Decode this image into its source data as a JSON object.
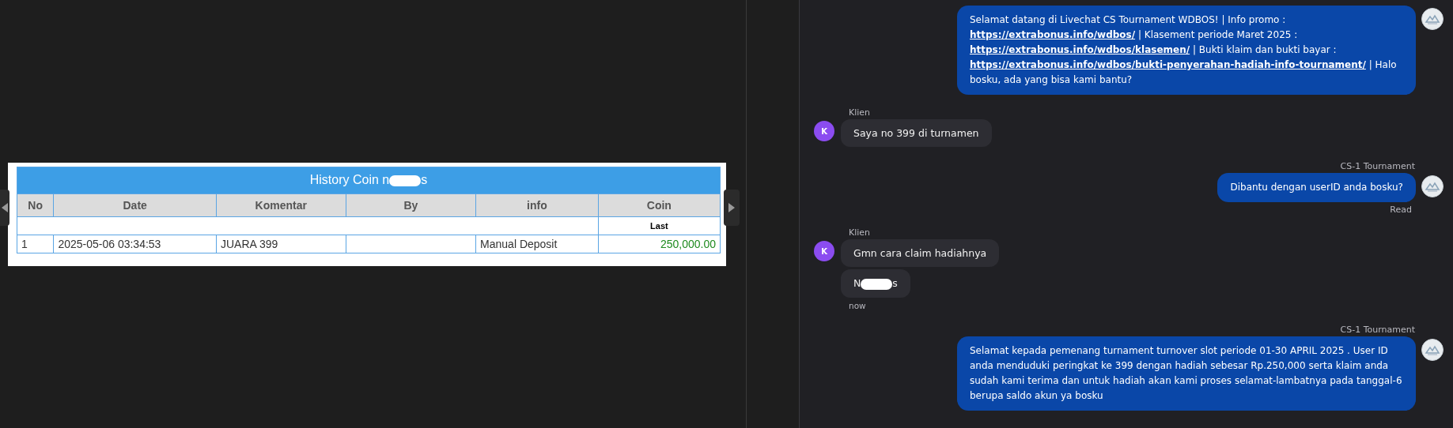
{
  "history_table": {
    "title_before": "History Coin n",
    "title_after": "s",
    "redacted": true,
    "columns": [
      "No",
      "Date",
      "Komentar",
      "By",
      "info",
      "Coin"
    ],
    "subheader": "Last",
    "rows": [
      {
        "no": "1",
        "date": "2025-05-06 03:34:53",
        "komentar": "JUARA 399",
        "by": "",
        "info": "Manual Deposit",
        "coin": "250,000.00"
      }
    ]
  },
  "chat": {
    "messages": [
      {
        "kind": "agent",
        "parts": [
          {
            "kind": "text",
            "text": "Selamat datang di Livechat CS Tournament WDBOS! | Info promo : "
          },
          {
            "kind": "link",
            "text": "https://extrabonus.info/wdbos/"
          },
          {
            "kind": "text",
            "text": " | Klasement periode Maret 2025 : "
          },
          {
            "kind": "link",
            "text": "https://extrabonus.info/wdbos/klasemen/"
          },
          {
            "kind": "text",
            "text": " | Bukti klaim dan bukti bayar : "
          },
          {
            "kind": "link",
            "text": "https://extrabonus.info/wdbos/bukti-penyerahan-hadiah-info-tournament/"
          },
          {
            "kind": "text",
            "text": " | Halo bosku, ada yang bisa kami bantu?"
          }
        ]
      },
      {
        "kind": "client",
        "sender": "Klien",
        "avatar": "K",
        "bubbles": [
          {
            "text": "Saya no 399 di turnamen"
          }
        ]
      },
      {
        "kind": "agent",
        "sender": "CS-1 Tournament",
        "status": "Read",
        "parts": [
          {
            "kind": "text",
            "text": "Dibantu dengan userID anda bosku?"
          }
        ]
      },
      {
        "kind": "client",
        "sender": "Klien",
        "avatar": "K",
        "time": "now",
        "bubbles": [
          {
            "text": "Gmn cara claim hadiahnya"
          },
          {
            "text_before": "N",
            "text_after": "s",
            "redacted": true
          }
        ]
      },
      {
        "kind": "agent",
        "sender": "CS-1 Tournament",
        "parts": [
          {
            "kind": "text",
            "text": "Selamat kepada pemenang turnament turnover slot periode 01-30 APRIL 2025 . User ID anda menduduki peringkat ke 399 dengan hadiah sebesar Rp.250,000 serta klaim anda sudah kami terima dan untuk hadiah akan kami proses selamat-lambatnya pada tanggal-6 berupa saldo akun ya bosku"
          }
        ]
      }
    ]
  }
}
